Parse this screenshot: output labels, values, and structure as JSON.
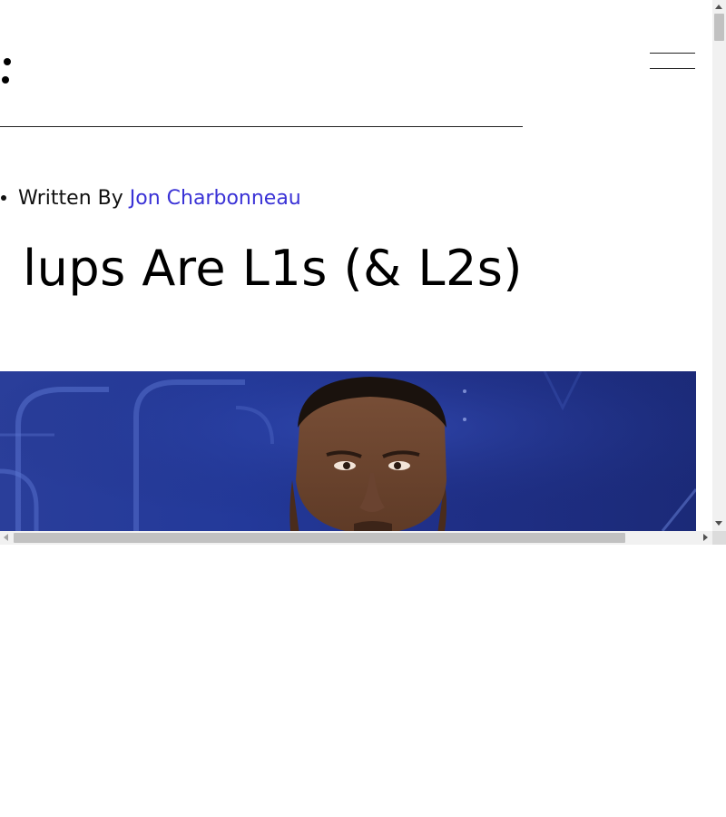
{
  "header": {
    "logo_icon": "colon-logo-icon",
    "menu_icon": "hamburger-menu-icon"
  },
  "article": {
    "byline_prefix": "Written By",
    "author": "Jon Charbonneau",
    "title": "lups Are L1s (& L2s)"
  },
  "hero_image": {
    "description_icon": "hero-photo"
  },
  "colors": {
    "link": "#3a32d6",
    "text": "#000000",
    "hero_background": "#23399a"
  }
}
